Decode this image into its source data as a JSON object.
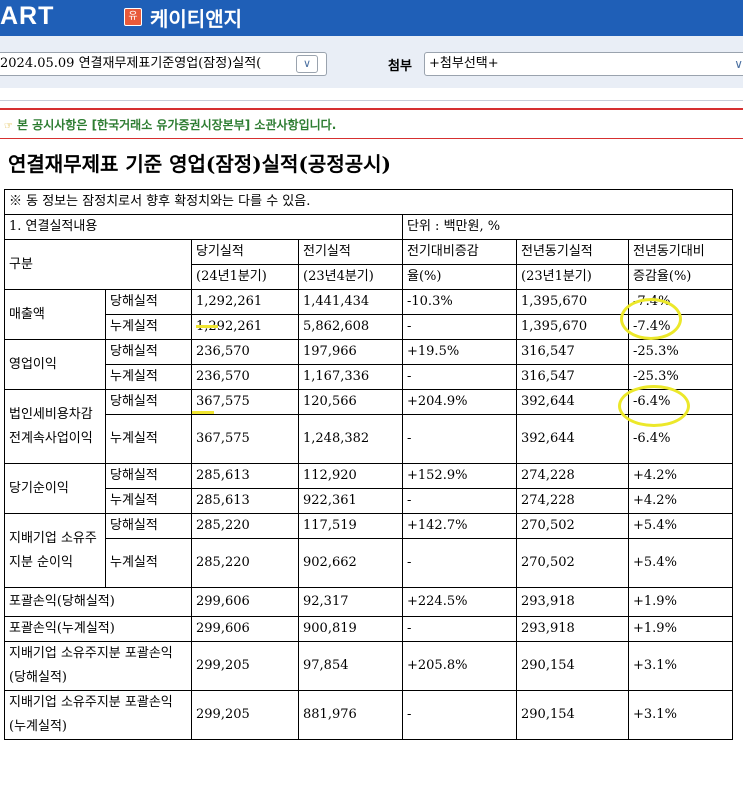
{
  "header": {
    "logo_text": "ART",
    "corp_badge": "유",
    "corp_name": "케이티앤지"
  },
  "toolbar": {
    "report_select_value": "2024.05.09  연결재무제표기준영업(잠정)실적(",
    "attach_label": "첨부",
    "attach_select_value": "+첨부선택+"
  },
  "notice": {
    "text": "본 공시사항은 [한국거래소 유가증권시장본부] 소관사항입니다."
  },
  "report": {
    "title": "연결재무제표 기준 영업(잠정)실적(공정공시)",
    "note": "※ 동 정보는 잠정치로서 향후 확정치와는 다를 수 있음.",
    "section": "1. 연결실적내용",
    "unit": "단위 : 백만원, %",
    "headers": {
      "category": "구분",
      "current": "당기실적",
      "current_period": "(24년1분기)",
      "previous": "전기실적",
      "previous_period": "(23년4분기)",
      "qoq": "전기대비증감",
      "qoq_unit": "율(%)",
      "yoy_actual": "전년동기실적",
      "yoy_period": "(23년1분기)",
      "yoy": "전년동기대비",
      "yoy_unit": "증감율(%)"
    },
    "groups": [
      {
        "label": "매출액",
        "rows": [
          {
            "sub": "당해실적",
            "cur": "1,292,261",
            "prev": "1,441,434",
            "qoq": "-10.3%",
            "yoyv": "1,395,670",
            "yoy": "-7.4%"
          },
          {
            "sub": "누계실적",
            "cur": "1,292,261",
            "prev": "5,862,608",
            "qoq": "-",
            "yoyv": "1,395,670",
            "yoy": "-7.4%"
          }
        ]
      },
      {
        "label": "영업이익",
        "rows": [
          {
            "sub": "당해실적",
            "cur": "236,570",
            "prev": "197,966",
            "qoq": "+19.5%",
            "yoyv": "316,547",
            "yoy": "-25.3%"
          },
          {
            "sub": "누계실적",
            "cur": "236,570",
            "prev": "1,167,336",
            "qoq": "-",
            "yoyv": "316,547",
            "yoy": "-25.3%"
          }
        ]
      },
      {
        "label": "법인세비용차감전계속사업이익",
        "rows": [
          {
            "sub": "당해실적",
            "cur": "367,575",
            "prev": "120,566",
            "qoq": "+204.9%",
            "yoyv": "392,644",
            "yoy": "-6.4%"
          },
          {
            "sub": "누계실적",
            "cur": "367,575",
            "prev": "1,248,382",
            "qoq": "-",
            "yoyv": "392,644",
            "yoy": "-6.4%"
          }
        ]
      },
      {
        "label": "당기순이익",
        "rows": [
          {
            "sub": "당해실적",
            "cur": "285,613",
            "prev": "112,920",
            "qoq": "+152.9%",
            "yoyv": "274,228",
            "yoy": "+4.2%"
          },
          {
            "sub": "누계실적",
            "cur": "285,613",
            "prev": "922,361",
            "qoq": "-",
            "yoyv": "274,228",
            "yoy": "+4.2%"
          }
        ]
      },
      {
        "label": "지배기업 소유주지분 순이익",
        "rows": [
          {
            "sub": "당해실적",
            "cur": "285,220",
            "prev": "117,519",
            "qoq": "+142.7%",
            "yoyv": "270,502",
            "yoy": "+5.4%"
          },
          {
            "sub": "누계실적",
            "cur": "285,220",
            "prev": "902,662",
            "qoq": "-",
            "yoyv": "270,502",
            "yoy": "+5.4%"
          }
        ]
      }
    ],
    "singles": [
      {
        "label": "포괄손익(당해실적)",
        "cur": "299,606",
        "prev": "92,317",
        "qoq": "+224.5%",
        "yoyv": "293,918",
        "yoy": "+1.9%"
      },
      {
        "label": "포괄손익(누계실적)",
        "cur": "299,606",
        "prev": "900,819",
        "qoq": "-",
        "yoyv": "293,918",
        "yoy": "+1.9%"
      },
      {
        "label": "지배기업 소유주지분 포괄손익(당해실적)",
        "cur": "299,205",
        "prev": "97,854",
        "qoq": "+205.8%",
        "yoyv": "290,154",
        "yoy": "+3.1%"
      },
      {
        "label": "지배기업 소유주지분 포괄손익(누계실적)",
        "cur": "299,205",
        "prev": "881,976",
        "qoq": "-",
        "yoyv": "290,154",
        "yoy": "+3.1%"
      }
    ]
  },
  "annotation_colors": {
    "highlight": "#f0e530"
  }
}
